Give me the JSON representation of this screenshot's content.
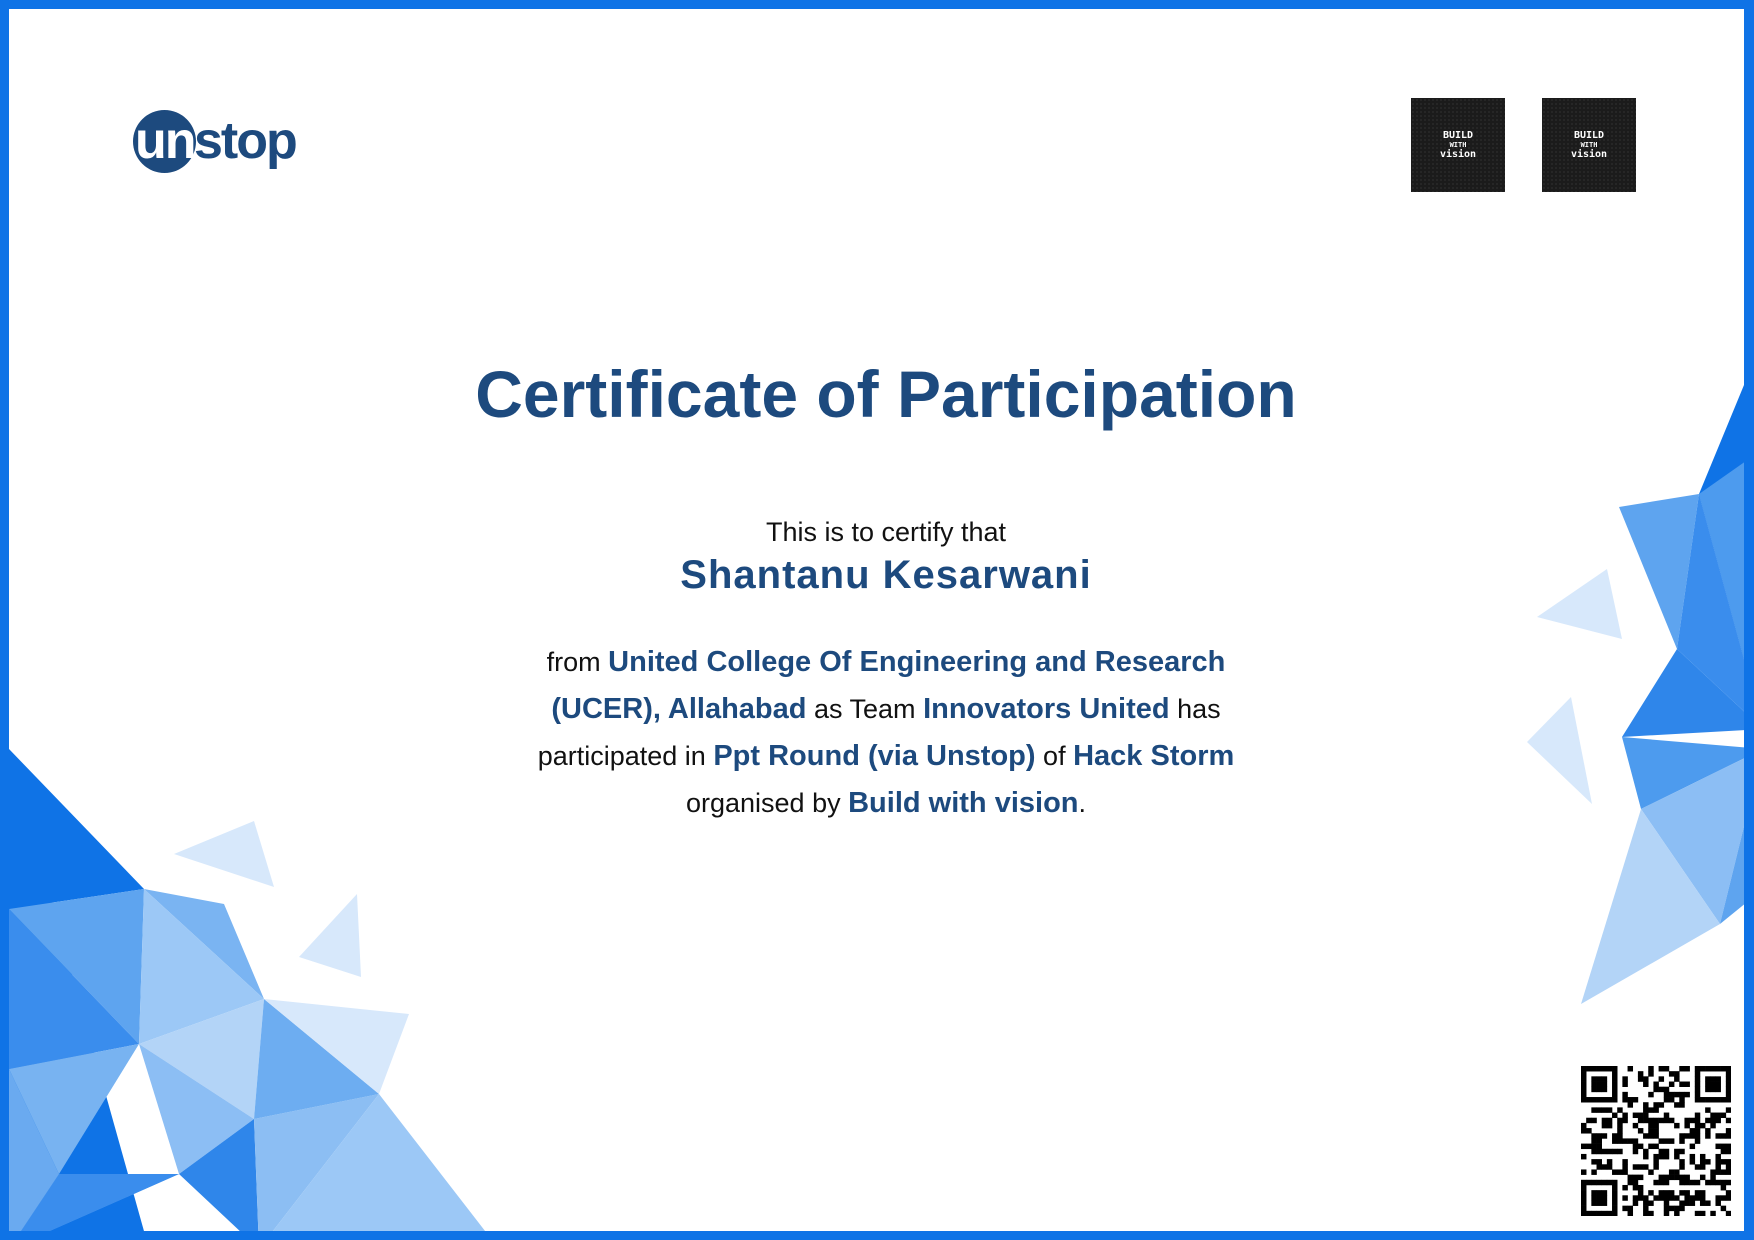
{
  "brand": {
    "logo_prefix": "un",
    "logo_suffix": "stop"
  },
  "organizer_badges": [
    {
      "line1": "BUILD",
      "line2": "WITH",
      "line3": "vision"
    },
    {
      "line1": "BUILD",
      "line2": "WITH",
      "line3": "vision"
    }
  ],
  "certificate": {
    "title": "Certificate of Participation",
    "certify_text": "This is to certify that",
    "recipient_name": "Shantanu Kesarwani",
    "from_word": "from",
    "college": "United College Of Engineering and Research (UCER), Allahabad",
    "as_team_word": "as Team",
    "team_name": "Innovators United",
    "participated_words": "has participated in",
    "round": "Ppt Round (via Unstop)",
    "of_word": "of",
    "event": "Hack Storm",
    "organised_by_words": "organised by",
    "organizer": "Build with vision",
    "end_punct": "."
  },
  "colors": {
    "frame_blue": "#0f73e6",
    "brand_navy": "#1d4a7e",
    "text_black": "#111111"
  },
  "icons": {
    "qr": "qr-code-icon",
    "decor": "polygon-triangles"
  }
}
